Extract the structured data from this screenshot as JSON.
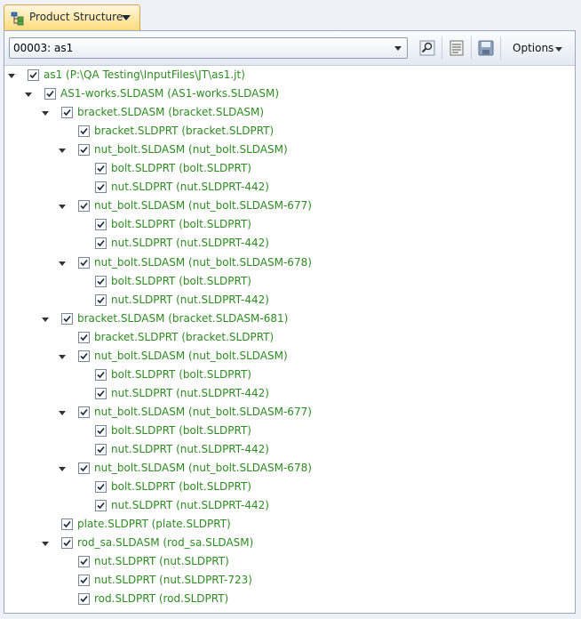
{
  "panel_tab": {
    "label": "Product Structure"
  },
  "toolbar": {
    "selector_value": "00003: as1",
    "options_label": "Options",
    "icons": [
      "find-icon",
      "list-icon",
      "save-icon"
    ]
  },
  "colors": {
    "node_text": "#2e8b22",
    "tab_accent": "#ffd879"
  },
  "tree": [
    {
      "label": "as1 (P:\\QA Testing\\InputFiles\\JT\\as1.jt)",
      "depth": 0,
      "expanded": true,
      "checked": true
    },
    {
      "label": "AS1-works.SLDASM (AS1-works.SLDASM)",
      "depth": 1,
      "expanded": true,
      "checked": true
    },
    {
      "label": "bracket.SLDASM (bracket.SLDASM)",
      "depth": 2,
      "expanded": true,
      "checked": true
    },
    {
      "label": "bracket.SLDPRT (bracket.SLDPRT)",
      "depth": 3,
      "expanded": false,
      "checked": true
    },
    {
      "label": "nut_bolt.SLDASM (nut_bolt.SLDASM)",
      "depth": 3,
      "expanded": true,
      "checked": true
    },
    {
      "label": "bolt.SLDPRT (bolt.SLDPRT)",
      "depth": 4,
      "expanded": false,
      "checked": true
    },
    {
      "label": "nut.SLDPRT (nut.SLDPRT-442)",
      "depth": 4,
      "expanded": false,
      "checked": true
    },
    {
      "label": "nut_bolt.SLDASM (nut_bolt.SLDASM-677)",
      "depth": 3,
      "expanded": true,
      "checked": true
    },
    {
      "label": "bolt.SLDPRT (bolt.SLDPRT)",
      "depth": 4,
      "expanded": false,
      "checked": true
    },
    {
      "label": "nut.SLDPRT (nut.SLDPRT-442)",
      "depth": 4,
      "expanded": false,
      "checked": true
    },
    {
      "label": "nut_bolt.SLDASM (nut_bolt.SLDASM-678)",
      "depth": 3,
      "expanded": true,
      "checked": true
    },
    {
      "label": "bolt.SLDPRT (bolt.SLDPRT)",
      "depth": 4,
      "expanded": false,
      "checked": true
    },
    {
      "label": "nut.SLDPRT (nut.SLDPRT-442)",
      "depth": 4,
      "expanded": false,
      "checked": true
    },
    {
      "label": "bracket.SLDASM (bracket.SLDASM-681)",
      "depth": 2,
      "expanded": true,
      "checked": true
    },
    {
      "label": "bracket.SLDPRT (bracket.SLDPRT)",
      "depth": 3,
      "expanded": false,
      "checked": true
    },
    {
      "label": "nut_bolt.SLDASM (nut_bolt.SLDASM)",
      "depth": 3,
      "expanded": true,
      "checked": true
    },
    {
      "label": "bolt.SLDPRT (bolt.SLDPRT)",
      "depth": 4,
      "expanded": false,
      "checked": true
    },
    {
      "label": "nut.SLDPRT (nut.SLDPRT-442)",
      "depth": 4,
      "expanded": false,
      "checked": true
    },
    {
      "label": "nut_bolt.SLDASM (nut_bolt.SLDASM-677)",
      "depth": 3,
      "expanded": true,
      "checked": true
    },
    {
      "label": "bolt.SLDPRT (bolt.SLDPRT)",
      "depth": 4,
      "expanded": false,
      "checked": true
    },
    {
      "label": "nut.SLDPRT (nut.SLDPRT-442)",
      "depth": 4,
      "expanded": false,
      "checked": true
    },
    {
      "label": "nut_bolt.SLDASM (nut_bolt.SLDASM-678)",
      "depth": 3,
      "expanded": true,
      "checked": true
    },
    {
      "label": "bolt.SLDPRT (bolt.SLDPRT)",
      "depth": 4,
      "expanded": false,
      "checked": true
    },
    {
      "label": "nut.SLDPRT (nut.SLDPRT-442)",
      "depth": 4,
      "expanded": false,
      "checked": true
    },
    {
      "label": "plate.SLDPRT (plate.SLDPRT)",
      "depth": 2,
      "expanded": false,
      "checked": true
    },
    {
      "label": "rod_sa.SLDASM (rod_sa.SLDASM)",
      "depth": 2,
      "expanded": true,
      "checked": true
    },
    {
      "label": "nut.SLDPRT (nut.SLDPRT)",
      "depth": 3,
      "expanded": false,
      "checked": true
    },
    {
      "label": "nut.SLDPRT (nut.SLDPRT-723)",
      "depth": 3,
      "expanded": false,
      "checked": true
    },
    {
      "label": "rod.SLDPRT (rod.SLDPRT)",
      "depth": 3,
      "expanded": false,
      "checked": true
    }
  ]
}
